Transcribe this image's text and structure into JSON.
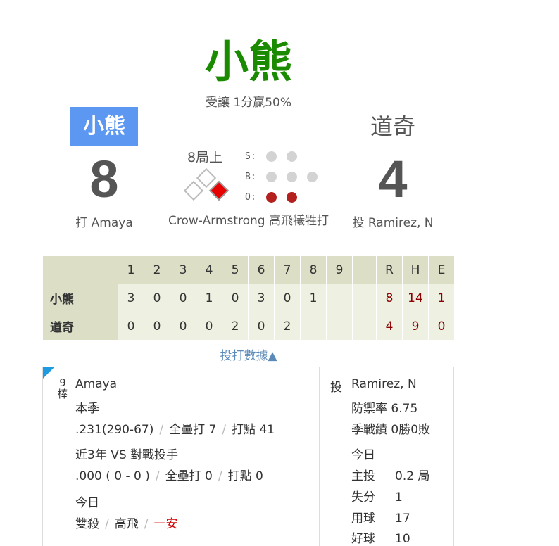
{
  "header": {
    "winner": "小熊",
    "spread": "受讓 1分贏50%"
  },
  "teams": {
    "away": {
      "name": "小熊",
      "score": "8"
    },
    "home": {
      "name": "道奇",
      "score": "4"
    }
  },
  "at_bat": {
    "batter": "打 Amaya",
    "pitcher": "投 Ramirez, N"
  },
  "situation": {
    "inning": "8局上",
    "bases": {
      "first": true,
      "second": false,
      "third": false
    },
    "count_labels": {
      "s": "S:",
      "b": "B:",
      "o": "O:"
    },
    "balls": 0,
    "strikes": 0,
    "outs": 2,
    "last_play": "Crow-Armstrong 高飛犧牲打"
  },
  "linescore": {
    "innings": [
      "1",
      "2",
      "3",
      "4",
      "5",
      "6",
      "7",
      "8",
      "9"
    ],
    "rhe": [
      "R",
      "H",
      "E"
    ],
    "rows": [
      {
        "team": "小熊",
        "runs": [
          "3",
          "0",
          "0",
          "1",
          "0",
          "3",
          "0",
          "1",
          ""
        ],
        "R": "8",
        "H": "14",
        "E": "1"
      },
      {
        "team": "道奇",
        "runs": [
          "0",
          "0",
          "0",
          "0",
          "2",
          "0",
          "2",
          "",
          ""
        ],
        "R": "4",
        "H": "9",
        "E": "0"
      }
    ]
  },
  "toggle_label": "投打數據▲",
  "batter_card": {
    "order": "9\n棒",
    "name": "Amaya",
    "season_label": "本季",
    "season_avg": ".231(290-67)",
    "season_hr": "全壘打 7",
    "season_rbi": "打點 41",
    "vs_label": "近3年 VS 對戰投手",
    "vs_avg": ".000 ( 0 - 0 )",
    "vs_hr": "全壘打 0",
    "vs_rbi": "打點 0",
    "today_label": "今日",
    "today_1": "雙殺",
    "today_2": "高飛",
    "today_3": "一安"
  },
  "pitcher_card": {
    "tag": "投",
    "name": "Ramirez, N",
    "era": "防禦率 6.75",
    "record": "季戰績 0勝0敗",
    "today_label": "今日",
    "stats": [
      {
        "k": "主投",
        "v": "0.2 局"
      },
      {
        "k": "失分",
        "v": "1"
      },
      {
        "k": "用球",
        "v": "17"
      },
      {
        "k": "好球",
        "v": "10"
      }
    ]
  }
}
